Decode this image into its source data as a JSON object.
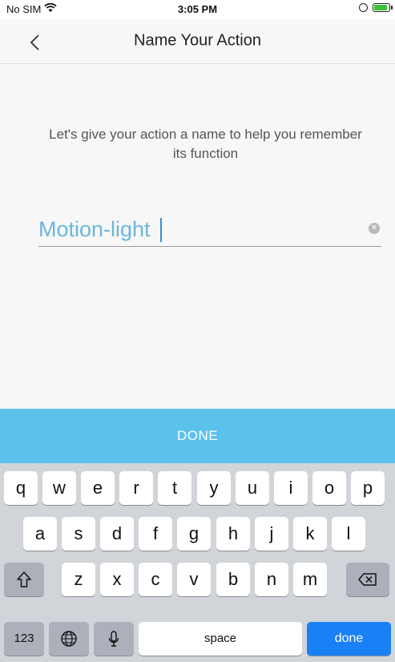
{
  "status_bar": {
    "carrier": "No SIM",
    "time": "3:05 PM"
  },
  "nav": {
    "title": "Name Your Action"
  },
  "main": {
    "instruction": "Let's give your action a name to help you remember its function",
    "name_field_value": "Motion-light"
  },
  "done_bar": {
    "label": "DONE"
  },
  "keyboard": {
    "row1": [
      "q",
      "w",
      "e",
      "r",
      "t",
      "y",
      "u",
      "i",
      "o",
      "p"
    ],
    "row2": [
      "a",
      "s",
      "d",
      "f",
      "g",
      "h",
      "j",
      "k",
      "l"
    ],
    "row3": [
      "z",
      "x",
      "c",
      "v",
      "b",
      "n",
      "m"
    ],
    "numbers_label": "123",
    "space_label": "space",
    "done_label": "done"
  },
  "colors": {
    "accent": "#5bc2ec",
    "input_text": "#6ab6e0",
    "keyboard_done": "#1a80f5",
    "keyboard_bg": "#d1d4d9"
  },
  "icons": [
    "wifi-icon",
    "orientation-lock-icon",
    "battery-icon",
    "back-chevron-icon",
    "clear-text-icon",
    "shift-icon",
    "backspace-icon",
    "globe-icon",
    "microphone-icon"
  ]
}
